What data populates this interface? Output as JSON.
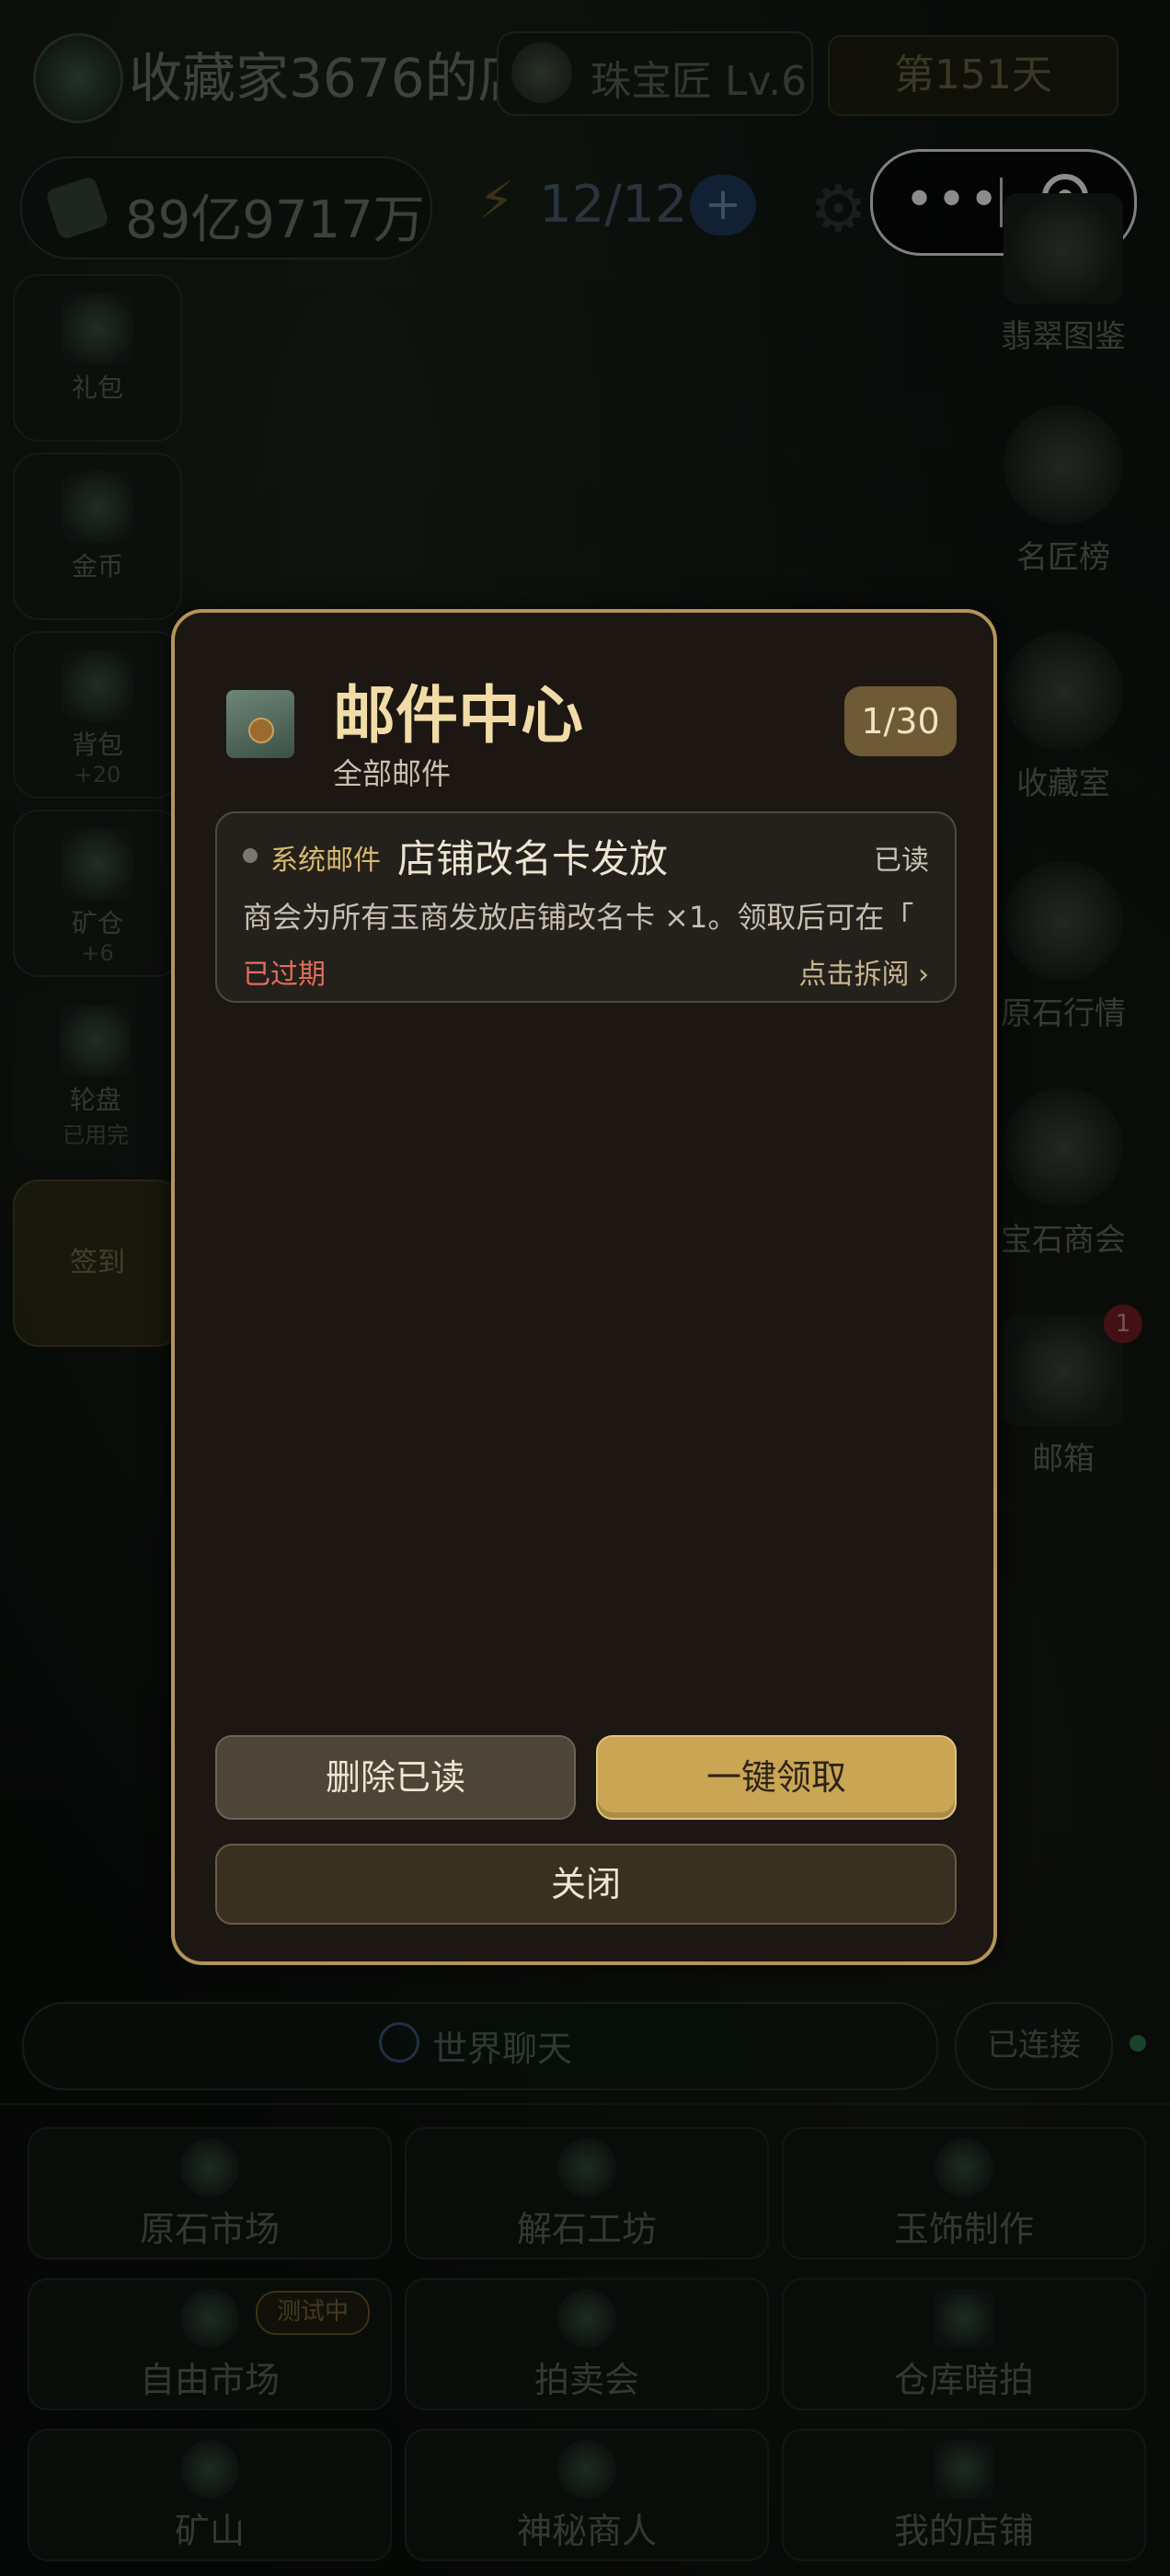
{
  "header": {
    "shop_name": "收藏家3676的店",
    "level": "珠宝匠 Lv.6",
    "day": "第151天",
    "money": "89亿9717万",
    "energy": "12/12",
    "energy_plus": "+"
  },
  "left_menu": [
    {
      "label": "礼包",
      "sub": ""
    },
    {
      "label": "金币",
      "sub": ""
    },
    {
      "label": "背包",
      "sub": "+20"
    },
    {
      "label": "矿仓",
      "sub": "+6"
    },
    {
      "label": "轮盘",
      "sub": "已用完"
    }
  ],
  "signin": "签到",
  "right_menu": [
    {
      "label": "翡翠图鉴"
    },
    {
      "label": "名匠榜"
    },
    {
      "label": "收藏室"
    },
    {
      "label": "原石行情"
    },
    {
      "label": "宝石商会"
    },
    {
      "label": "邮箱"
    }
  ],
  "mailbox_badge": "1",
  "chat": {
    "world_chat": "世界聊天",
    "status": "已连接"
  },
  "grid": [
    {
      "label": "原石市场"
    },
    {
      "label": "解石工坊"
    },
    {
      "label": "玉饰制作"
    },
    {
      "label": "自由市场",
      "tag": "测试中"
    },
    {
      "label": "拍卖会"
    },
    {
      "label": "仓库暗拍"
    },
    {
      "label": "矿山"
    },
    {
      "label": "神秘商人"
    },
    {
      "label": "我的店铺"
    }
  ],
  "modal": {
    "title": "邮件中心",
    "subtitle": "全部邮件",
    "count": "1/30",
    "mails": [
      {
        "category": "系统邮件",
        "title": "店铺改名卡发放",
        "status": "已读",
        "body": "商会为所有玉商发放店铺改名卡 ×1。领取后可在「",
        "expired": "已过期",
        "open": "点击拆阅 ›"
      }
    ],
    "delete_read": "删除已读",
    "claim_all": "一键领取",
    "close": "关闭"
  },
  "colors": {
    "accent_gold": "#c9a554",
    "modal_border": "#b49458",
    "expired_red": "#e06e5a"
  }
}
